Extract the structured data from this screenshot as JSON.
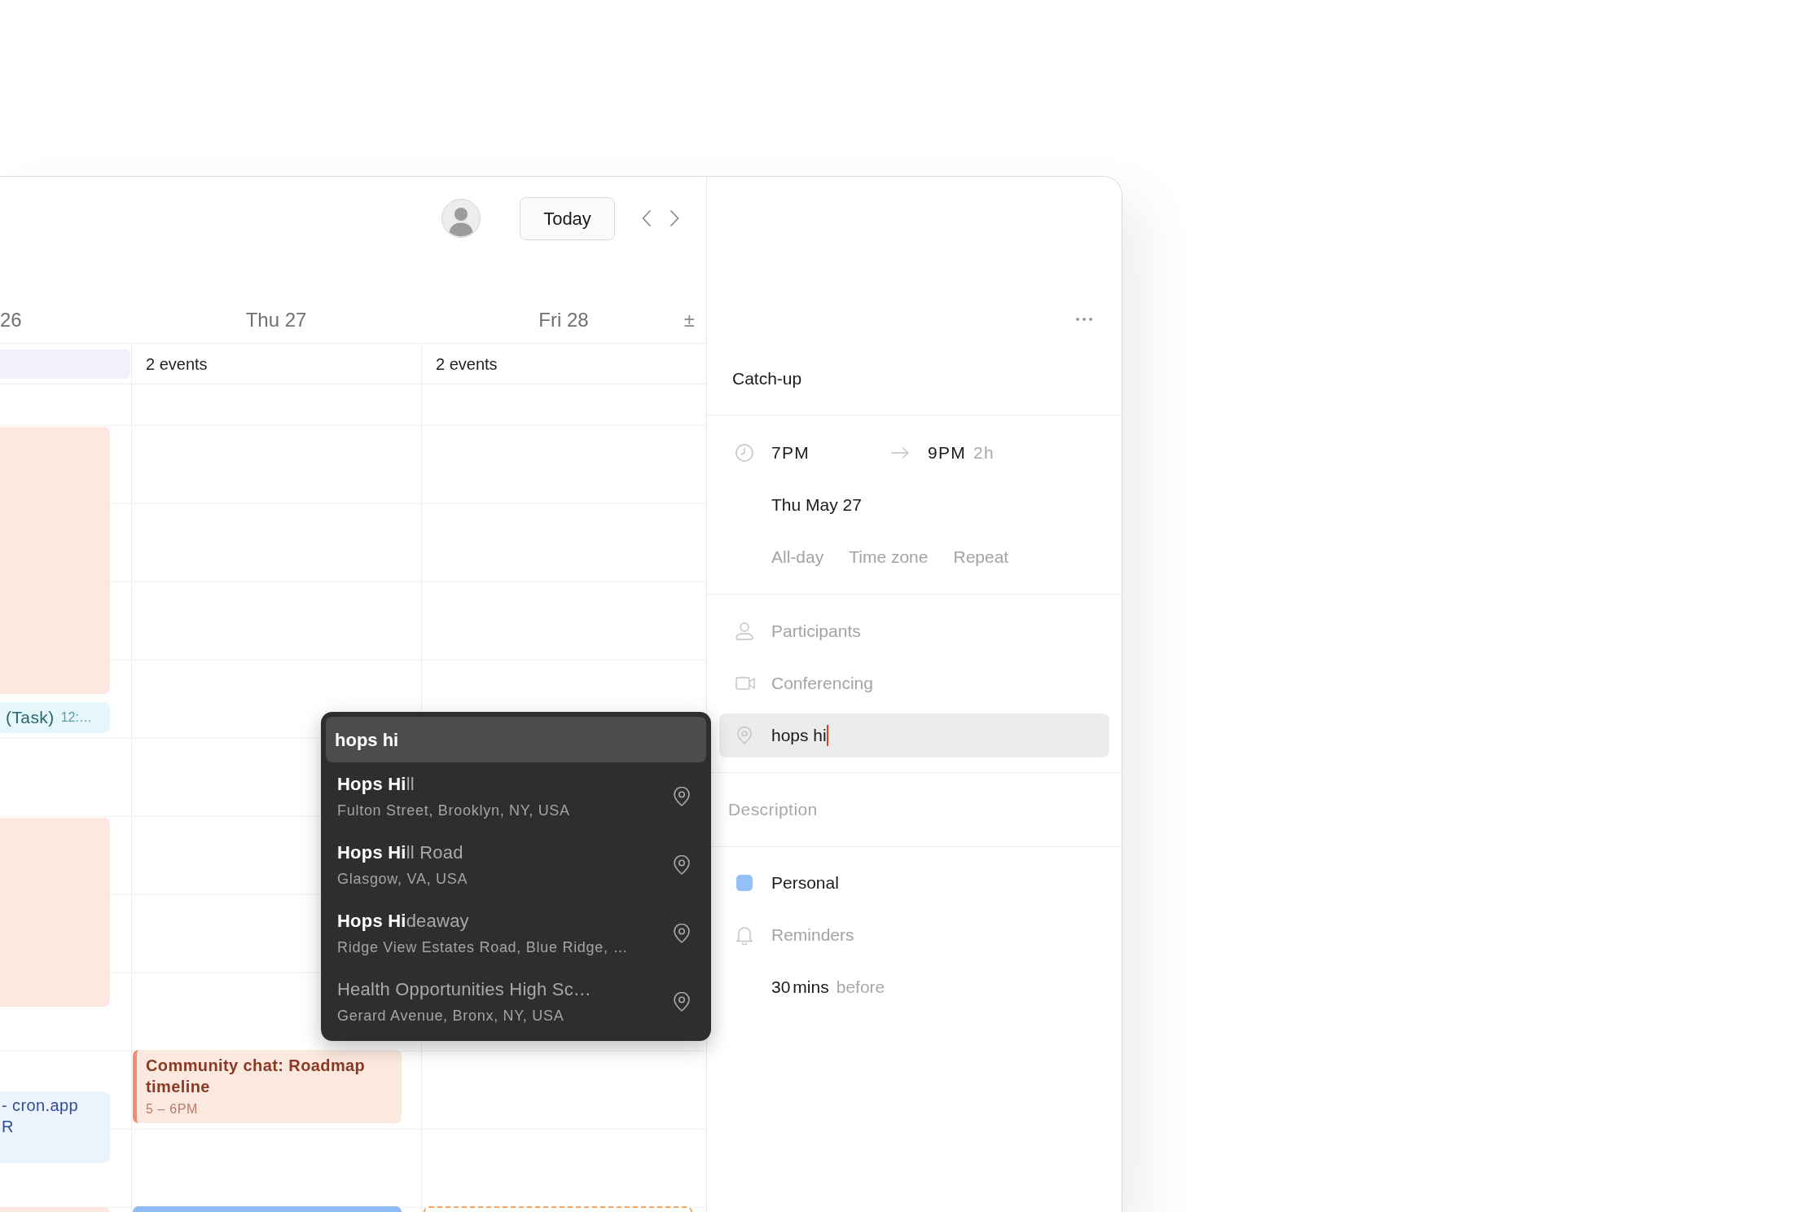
{
  "toolbar": {
    "today_button": "Today"
  },
  "day_headers": [
    "26",
    "Thu 27",
    "Fri 28"
  ],
  "all_day_toggle": "±",
  "all_day": [
    {
      "kind": "block",
      "color": "#f2f0fd"
    },
    {
      "kind": "count",
      "label": "2 events"
    },
    {
      "kind": "count",
      "label": "2 events"
    }
  ],
  "columns": [
    {
      "events": [
        {
          "kind": "block",
          "color": "#fbe8df"
        },
        {
          "kind": "task",
          "color": "#e5f7fa",
          "title": "(Task)",
          "time": "12:…"
        },
        {
          "kind": "block",
          "color": "#fbe8df"
        },
        {
          "kind": "block",
          "color": "#edf3fd",
          "title_lines": [
            "- cron.app",
            "R"
          ]
        },
        {
          "kind": "block",
          "color": "#fbe8df"
        }
      ]
    },
    {
      "events": [
        {
          "kind": "accent",
          "color": "#fbe8df",
          "title": "Community chat: Roadmap timeline",
          "time": "5 – 6PM"
        },
        {
          "kind": "block",
          "color": "#8dbcf5"
        }
      ]
    },
    {
      "events": [
        {
          "kind": "outline",
          "color": "#f4a25e"
        }
      ]
    }
  ],
  "location_search": {
    "query": "hops hi",
    "results": [
      {
        "title": "**Hops Hi**ll",
        "address": "Fulton Street, Brooklyn, NY, USA",
        "selected": false
      },
      {
        "title": "**Hops Hi**ll Road",
        "address": "Glasgow, VA, USA",
        "selected": false
      },
      {
        "title": "**Hops Hi**deaway",
        "address": "Ridge View Estates Road, Blue Ridge, …",
        "selected": false
      },
      {
        "title": "Health Opportunities High Sc…",
        "address": "Gerard Avenue, Bronx, NY, USA",
        "selected": false
      }
    ]
  },
  "event_panel": {
    "title": "Catch-up",
    "start_time": "7PM",
    "end_time": "9PM",
    "duration": "2h",
    "date": "Thu May 27",
    "options": [
      "All-day",
      "Time zone",
      "Repeat"
    ],
    "participants": "Participants",
    "conferencing": "Conferencing",
    "location": {
      "value": "hops hi",
      "focused": true
    },
    "description": {
      "placeholder": "Description"
    },
    "calendar": {
      "name": "Personal",
      "color": "#93c1f7"
    },
    "reminders": "Reminders",
    "reminder": {
      "value": "30",
      "unit": "mins",
      "suffix": "before"
    }
  }
}
